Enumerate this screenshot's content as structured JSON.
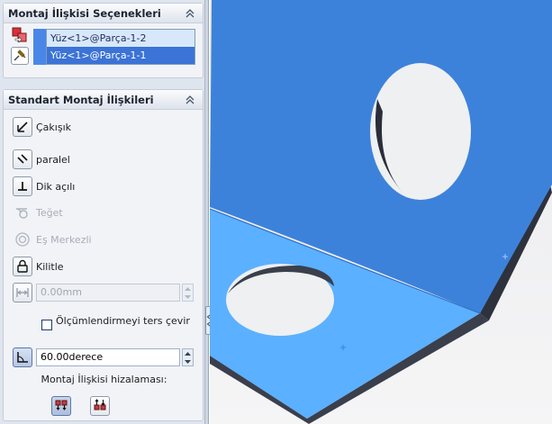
{
  "mate_selections": {
    "title": "Montaj İlişkisi Seçenekleri",
    "items": [
      {
        "label": "Yüz<1>@Parça-1-2",
        "selected": false
      },
      {
        "label": "Yüz<1>@Parça-1-1",
        "selected": true
      }
    ]
  },
  "standard_mates": {
    "title": "Standart Montaj İlişkileri",
    "coincident": "Çakışık",
    "parallel": "paralel",
    "perpendicular": "Dik açılı",
    "tangent": "Teğet",
    "concentric": "Eş Merkezli",
    "lock": "Kilitle",
    "distance_value": "0.00mm",
    "flip_dimension_label": "Ölçümlendirmeyi ters çevir",
    "flip_dimension_checked": false,
    "angle_value": "60.00derece",
    "alignment_label": "Montaj İlişkisi hizalaması:"
  },
  "icons": {
    "collapse": "double-chevron-up-icon",
    "mate_selection": "mate-selection-icon",
    "pin": "pushpin-icon",
    "coincident": "coincident-icon",
    "parallel": "parallel-icon",
    "perpendicular": "perpendicular-icon",
    "tangent": "tangent-icon",
    "concentric": "concentric-icon",
    "lock": "lock-icon",
    "distance": "distance-icon",
    "angle": "angle-icon",
    "aligned": "aligned-icon",
    "anti_aligned": "anti-aligned-icon"
  },
  "colors": {
    "part_light": "#5bb0ff",
    "part_dark": "#3d82da",
    "edge_dark": "#2a2e3a",
    "selection_active": "#3b73d6"
  }
}
